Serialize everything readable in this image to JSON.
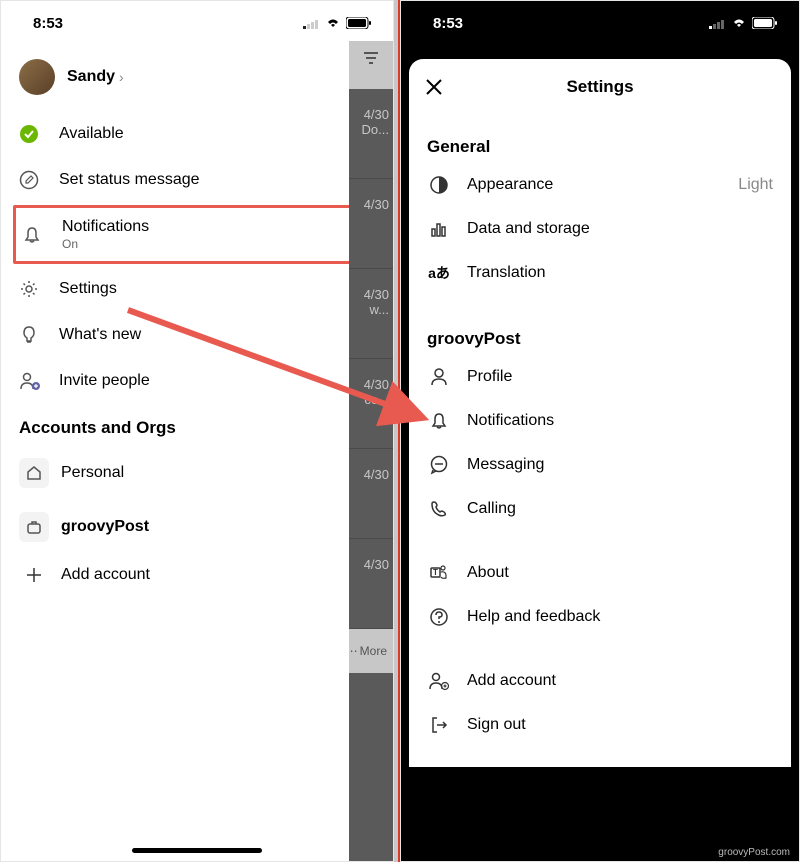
{
  "status": {
    "time": "8:53"
  },
  "left": {
    "profile_name": "Sandy",
    "status_label": "Available",
    "set_status": "Set status message",
    "notifications": {
      "label": "Notifications",
      "sub": "On"
    },
    "settings": "Settings",
    "whats_new": "What's new",
    "invite": "Invite people",
    "accounts_heading": "Accounts and Orgs",
    "accounts": {
      "personal": "Personal",
      "org": "groovyPost",
      "add": "Add account"
    },
    "gutter": {
      "date": "4/30",
      "snippets": [
        "Do...",
        "",
        "w...",
        "...",
        "ce...",
        ""
      ],
      "more": "More"
    }
  },
  "right": {
    "title": "Settings",
    "general": {
      "heading": "General",
      "appearance": {
        "label": "Appearance",
        "value": "Light"
      },
      "data": "Data and storage",
      "translation": "Translation"
    },
    "org": {
      "heading": "groovyPost",
      "profile": "Profile",
      "notifications": "Notifications",
      "messaging": "Messaging",
      "calling": "Calling"
    },
    "about": "About",
    "help": "Help and feedback",
    "add_account": "Add account",
    "sign_out": "Sign out"
  },
  "watermark": "groovyPost.com"
}
